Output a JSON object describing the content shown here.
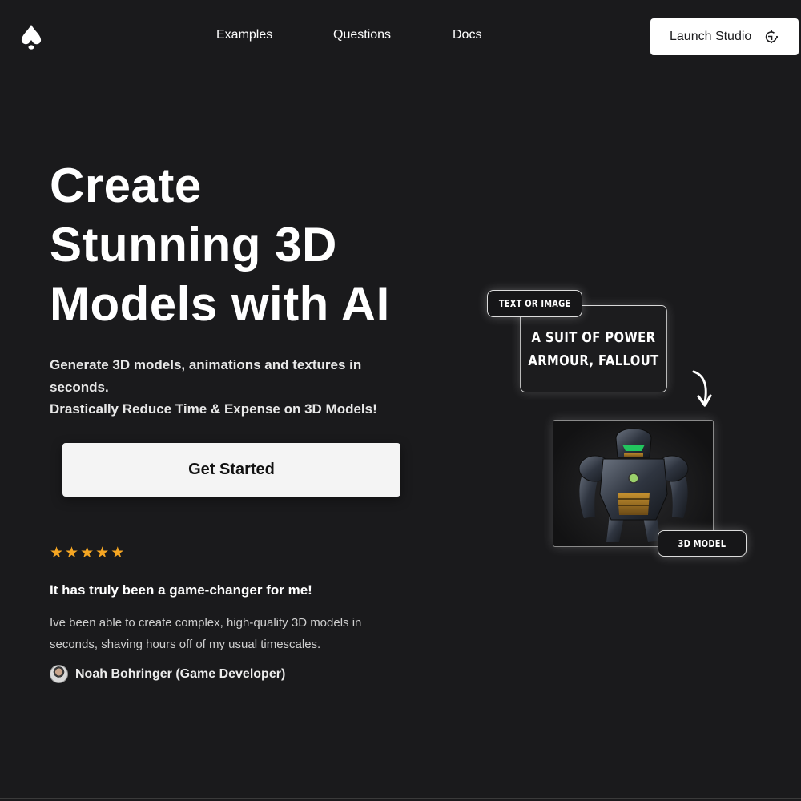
{
  "nav": {
    "links": [
      "Examples",
      "Questions",
      "Docs"
    ],
    "launch_label": "Launch Studio"
  },
  "hero": {
    "title_lines": [
      "Create",
      "Stunning 3D",
      "Models with AI"
    ],
    "subtitle_lines": [
      "Generate 3D models, animations and textures in",
      "seconds.",
      "Drastically Reduce Time & Expense on 3D Models!"
    ],
    "cta_label": "Get Started"
  },
  "testimonial": {
    "stars": 5,
    "title": "It has truly been a game-changer for me!",
    "body_lines": [
      "Ive been able to create complex, high-quality 3D models in",
      "seconds, shaving hours off of my usual timescales."
    ],
    "author": "Noah Bohringer (Game Developer)"
  },
  "illustration": {
    "input_tag": "TEXT OR IMAGE",
    "prompt_lines": [
      "A SUIT OF POWER",
      "ARMOUR, FALLOUT"
    ],
    "output_tag": "3D MODEL"
  },
  "colors": {
    "background": "#1a1a1c",
    "star": "#f5a623",
    "visor": "#22c55e"
  }
}
